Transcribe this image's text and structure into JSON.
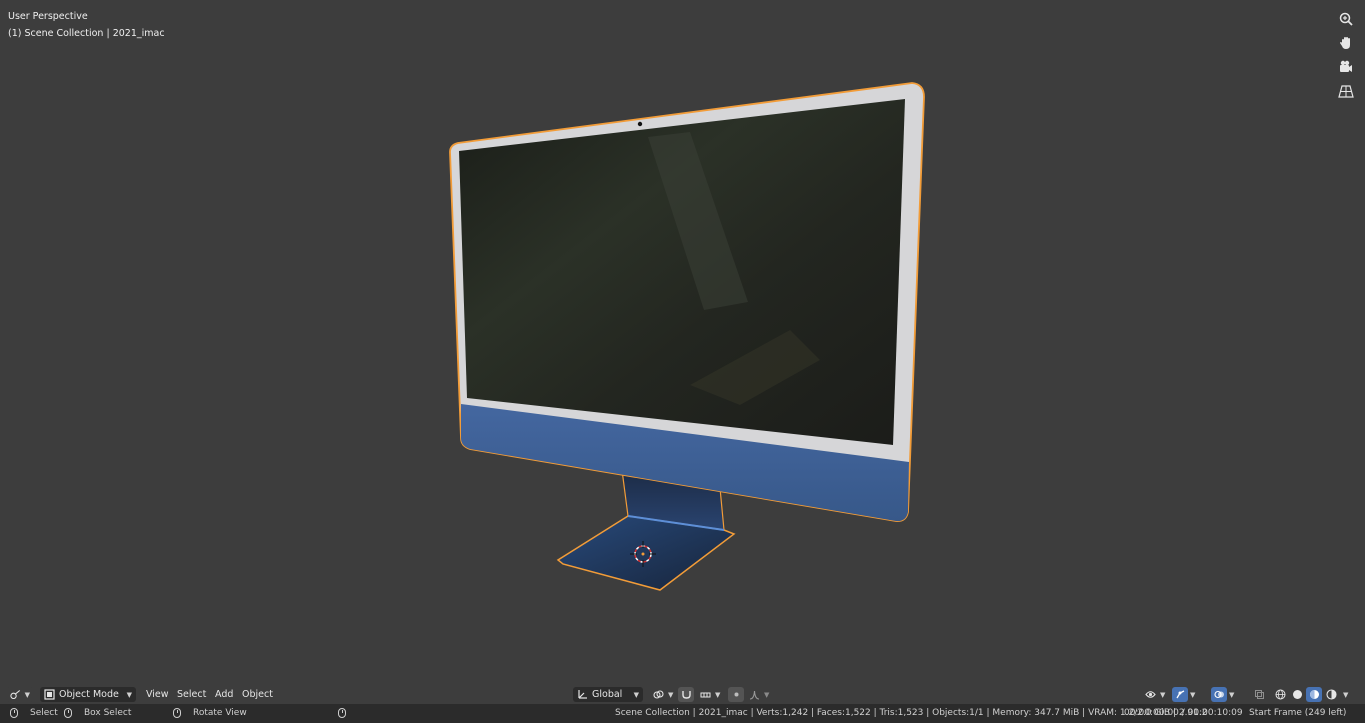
{
  "viewport": {
    "view_name": "User Perspective",
    "collection_info": "(1) Scene Collection | 2021_imac"
  },
  "header": {
    "mode": "Object Mode",
    "menus": [
      "View",
      "Select",
      "Add",
      "Object"
    ],
    "transform_orientation": "Global"
  },
  "status": {
    "select": "Select",
    "box_select": "Box Select",
    "rotate_view": "Rotate View",
    "stats": "Scene Collection | 2021_imac | Verts:1,242 | Faces:1,522 | Tris:1,523 | Objects:1/1 | Memory: 347.7 MiB | VRAM: 1.2/2.0 GiB | 2.91.2",
    "timecode": "00:00:00:00 / 00:00:10:09",
    "start_frame": "Start Frame (249 left)"
  },
  "colors": {
    "background": "#3d3d3d",
    "selection_outline": "#f29c38",
    "body_blue": "#3d5f95",
    "active_button": "#4772b3"
  },
  "icons": [
    "zoom-icon",
    "hand-pan-icon",
    "camera-icon",
    "perspective-grid-icon",
    "editor-type-icon",
    "object-mode-icon",
    "orientation-icon",
    "pivot-icon",
    "snap-icon",
    "proportional-icon",
    "visibility-icon",
    "gizmo-icon",
    "overlay-icon",
    "xray-icon",
    "wireframe-shading-icon",
    "solid-shading-icon",
    "material-shading-icon",
    "rendered-shading-icon",
    "mouse-icon",
    "3d-cursor-icon"
  ]
}
